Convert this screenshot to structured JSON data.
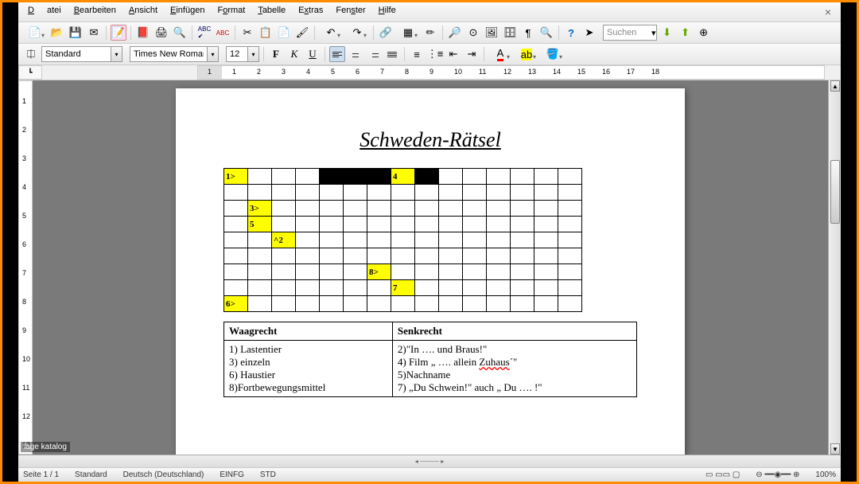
{
  "menu": {
    "items": [
      "Datei",
      "Bearbeiten",
      "Ansicht",
      "Einfügen",
      "Format",
      "Tabelle",
      "Extras",
      "Fenster",
      "Hilfe"
    ]
  },
  "close_label": "×",
  "toolbar2": {
    "style_label": "Standard",
    "font_label": "Times New Roman",
    "size_label": "12",
    "bold": "F",
    "italic": "K",
    "underline": "U"
  },
  "search": {
    "placeholder": "Suchen"
  },
  "hruler": {
    "marks": [
      "1",
      "1",
      "2",
      "3",
      "4",
      "5",
      "6",
      "7",
      "8",
      "9",
      "10",
      "11",
      "12",
      "13",
      "14",
      "15",
      "16",
      "17",
      "18"
    ]
  },
  "vruler": {
    "marks": [
      "1",
      "2",
      "3",
      "4",
      "5",
      "6",
      "7",
      "8",
      "9",
      "10",
      "11",
      "12",
      "13"
    ]
  },
  "document": {
    "title": "Schweden-Rätsel",
    "grid": {
      "rows": 9,
      "cols": 15,
      "cells": {
        "0-0": {
          "text": "1>",
          "cls": "yellow"
        },
        "0-4": {
          "text": "",
          "cls": "black"
        },
        "0-5": {
          "text": "",
          "cls": "black"
        },
        "0-6": {
          "text": "",
          "cls": "black"
        },
        "0-7": {
          "text": "4",
          "cls": "yellow"
        },
        "0-8": {
          "text": "",
          "cls": "black"
        },
        "2-1": {
          "text": "3>",
          "cls": "yellow"
        },
        "3-1": {
          "text": "5",
          "cls": "yellow"
        },
        "4-2": {
          "text": "^2",
          "cls": "yellow"
        },
        "6-6": {
          "text": "8>",
          "cls": "yellow"
        },
        "7-7": {
          "text": "7",
          "cls": "yellow"
        },
        "8-0": {
          "text": "6>",
          "cls": "yellow"
        }
      }
    },
    "clues": {
      "across_header": "Waagrecht",
      "down_header": "Senkrecht",
      "across": [
        "1) Lastentier",
        "3) einzeln",
        "6) Haustier",
        "8)Fortbewegungsmittel"
      ],
      "down": [
        "2)\"In …. und Braus!\"",
        "4) Film „ …. allein Zuhaus´\"",
        "5)Nachname",
        "7) „Du Schwein!\" auch „ Du …. !\""
      ],
      "wavy_word": "Zuhaus"
    }
  },
  "status": {
    "page": "Seite 1 / 1",
    "style": "Standard",
    "lang": "Deutsch (Deutschland)",
    "mode": "EINFG",
    "std": "STD",
    "zoom": "100%"
  },
  "tag": "lage katalog"
}
